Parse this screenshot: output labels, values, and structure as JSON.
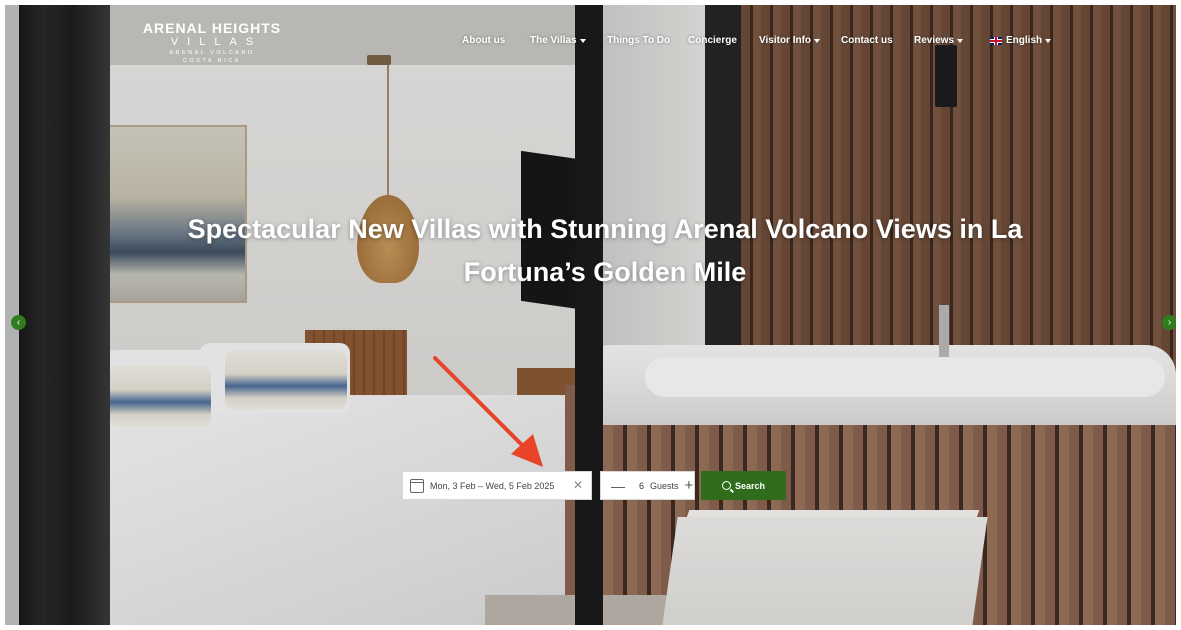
{
  "brand": {
    "name": "ARENAL HEIGHTS",
    "sub": "VILLAS",
    "line1": "ARENAL VOLCANO",
    "line2": "COSTA RICA"
  },
  "nav": {
    "items": [
      {
        "label": "About us",
        "dropdown": false
      },
      {
        "label": "The Villas",
        "dropdown": true
      },
      {
        "label": "Things To Do",
        "dropdown": false
      },
      {
        "label": "Concierge",
        "dropdown": false
      },
      {
        "label": "Visitor Info",
        "dropdown": true
      },
      {
        "label": "Contact us",
        "dropdown": false
      },
      {
        "label": "Reviews",
        "dropdown": true
      }
    ],
    "language": {
      "label": "English",
      "dropdown": true
    }
  },
  "hero": {
    "headline_line1": "Spectacular New Villas with Stunning Arenal Volcano Views in La",
    "headline_line2": "Fortuna’s Golden Mile",
    "prev_icon": "chevron-left-icon",
    "next_icon": "chevron-right-icon"
  },
  "booking": {
    "date_range": "Mon, 3 Feb – Wed, 5 Feb 2025",
    "clear_symbol": "✕",
    "guests_count": "6",
    "guests_label": "Guests",
    "minus_symbol": "—",
    "plus_symbol": "+",
    "search_label": "Search"
  },
  "colors": {
    "accent": "#2f6d1c",
    "annotation": "#e8442a"
  }
}
